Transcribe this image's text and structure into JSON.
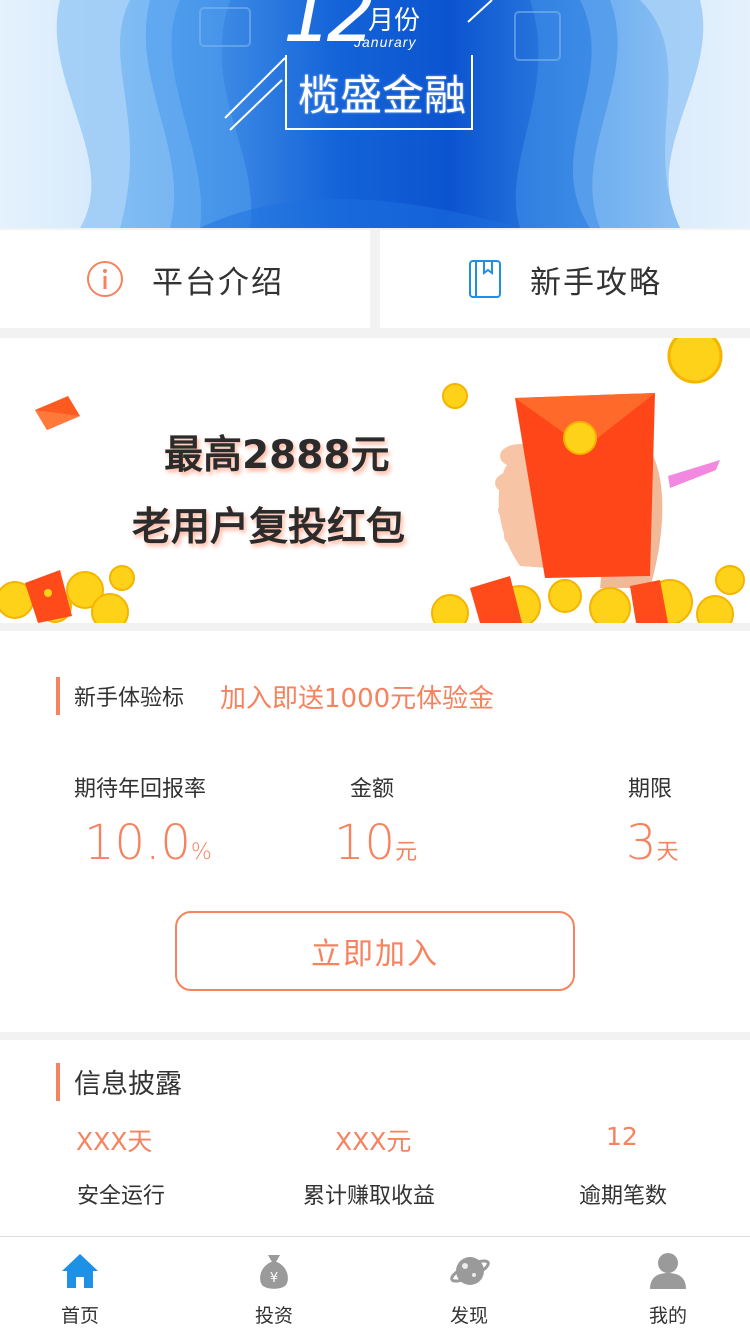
{
  "banner": {
    "month_number": "12",
    "month_cn": "月份",
    "month_en": "Janurary",
    "brand": "榄盛金融"
  },
  "quick_links": [
    {
      "label": "平台介绍",
      "icon": "info-circle-icon"
    },
    {
      "label": "新手攻略",
      "icon": "guide-book-icon"
    }
  ],
  "promo": {
    "line1": "最高2888元",
    "line2": "老用户复投红包"
  },
  "novice": {
    "title": "新手体验标",
    "tag": "加入即送1000元体验金",
    "metrics": [
      {
        "label": "期待年回报率",
        "value": "10.0",
        "unit": "%"
      },
      {
        "label": "金额",
        "value": "10",
        "unit": "元"
      },
      {
        "label": "期限",
        "value": "3",
        "unit": "天"
      }
    ],
    "join_label": "立即加入"
  },
  "disclosure": {
    "title": "信息披露",
    "stats": [
      {
        "value": "XXX天",
        "label": "安全运行"
      },
      {
        "value": "XXX元",
        "label": "累计赚取收益"
      },
      {
        "value": "12",
        "label": "逾期笔数"
      }
    ]
  },
  "tabbar": {
    "tabs": [
      {
        "label": "首页",
        "icon": "home-icon",
        "active": true
      },
      {
        "label": "投资",
        "icon": "money-bag-icon",
        "active": false
      },
      {
        "label": "发现",
        "icon": "planet-icon",
        "active": false
      },
      {
        "label": "我的",
        "icon": "user-icon",
        "active": false
      }
    ]
  },
  "colors": {
    "accent": "#f6825e",
    "active_tab": "#1e90e6",
    "inactive_tab": "#9a9a9a",
    "banner_blue": "#0b54cf"
  }
}
